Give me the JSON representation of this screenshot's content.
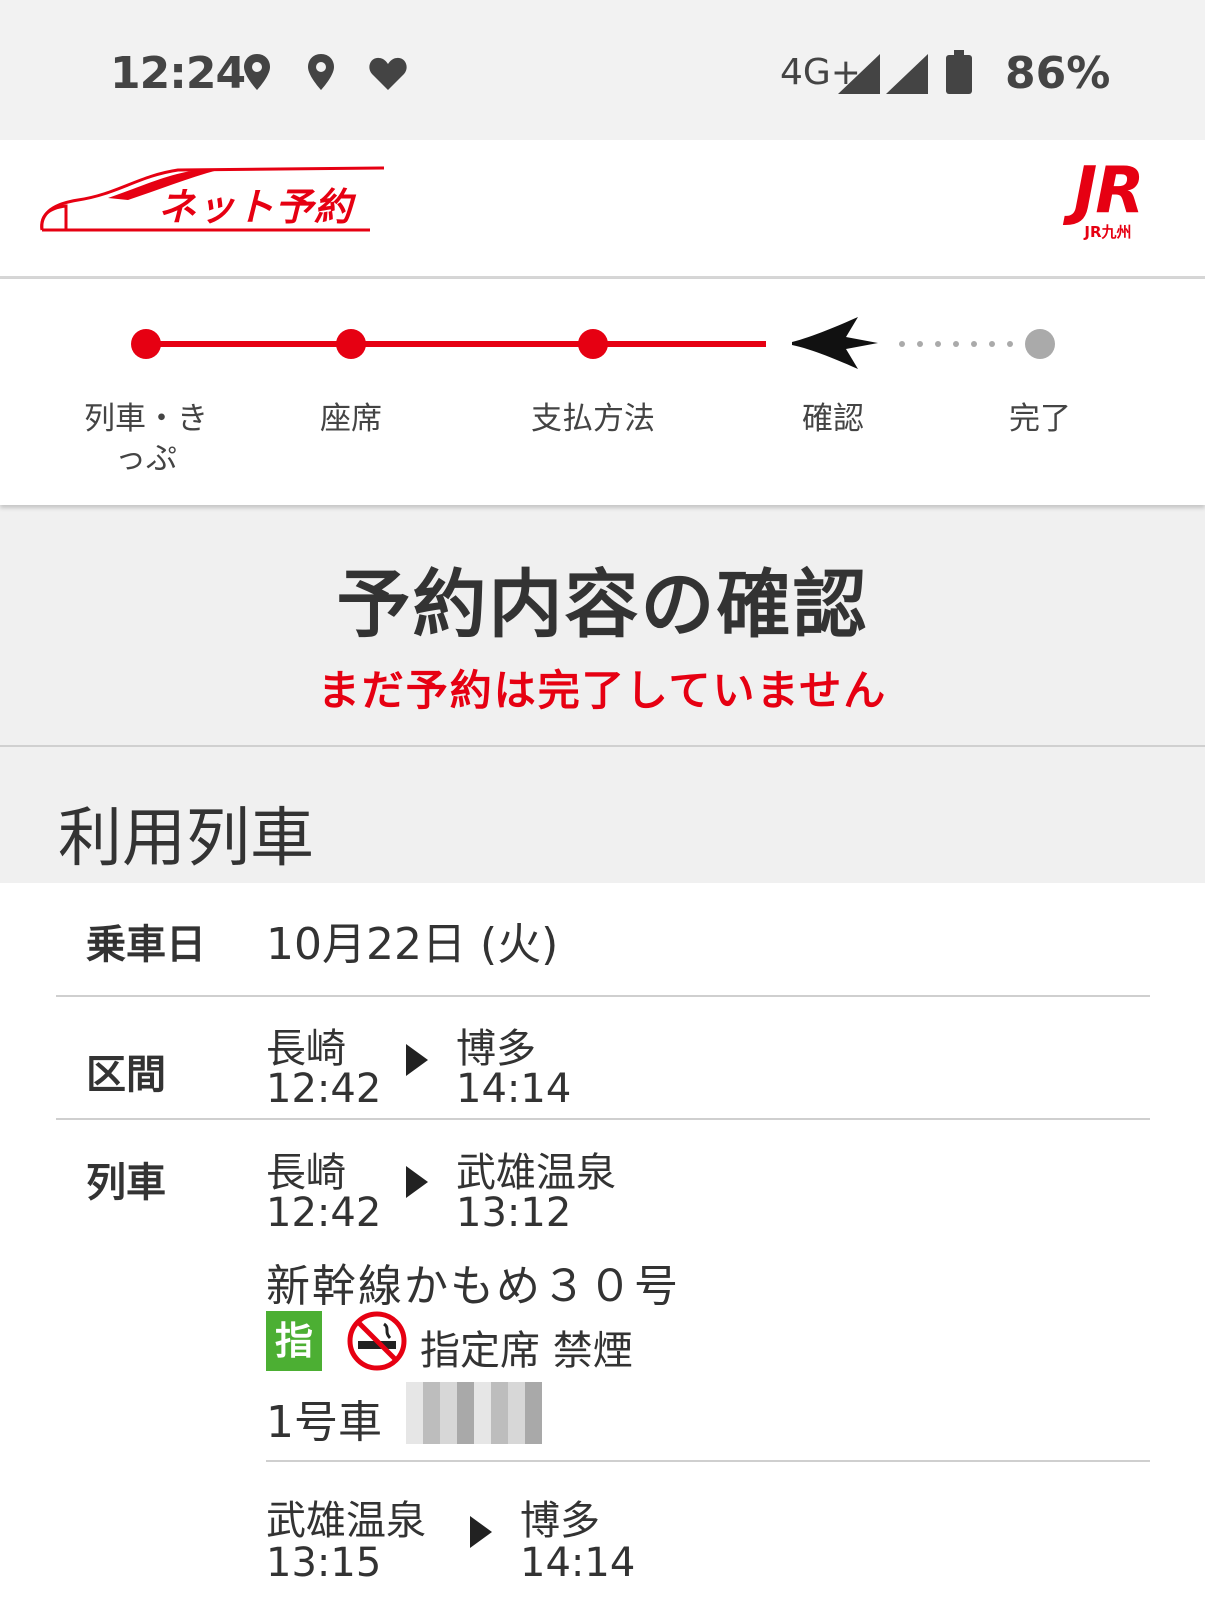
{
  "status_bar": {
    "time": "12:24",
    "network": "4G+",
    "battery": "86%",
    "icons": [
      "location-icon",
      "location-icon",
      "heart-icon",
      "signal-icon",
      "signal-icon",
      "battery-icon"
    ]
  },
  "app_bar": {
    "logo_text": "ネット予約",
    "brand_logo": "JR",
    "brand_sub": "JR九州"
  },
  "progress": {
    "steps": [
      {
        "label_line1": "列車・き",
        "label_line2": "っぷ",
        "state": "done"
      },
      {
        "label_line1": "座席",
        "state": "done"
      },
      {
        "label_line1": "支払方法",
        "state": "done"
      },
      {
        "label_line1": "確認",
        "state": "current"
      },
      {
        "label_line1": "完了",
        "state": "pending"
      }
    ],
    "active_color": "#e60012",
    "pending_color": "#aaaaaa"
  },
  "confirm": {
    "title": "予約内容の確認",
    "notice": "まだ予約は完了していません"
  },
  "section": {
    "title": "利用列車"
  },
  "details": {
    "date_label": "乗車日",
    "date_value": "10月22日 (火)",
    "route_label": "区間",
    "route": {
      "from": "長崎",
      "from_time": "12:42",
      "to": "博多",
      "to_time": "14:14"
    },
    "train_label": "列車",
    "legs": [
      {
        "from": "長崎",
        "from_time": "12:42",
        "to": "武雄温泉",
        "to_time": "13:12",
        "train_name": "新幹線かもめ３０号",
        "seat_badge": "指",
        "seat_type": "指定席 禁煙",
        "car": "1号車"
      },
      {
        "from": "武雄温泉",
        "from_time": "13:15",
        "to": "博多",
        "to_time": "14:14"
      }
    ]
  }
}
